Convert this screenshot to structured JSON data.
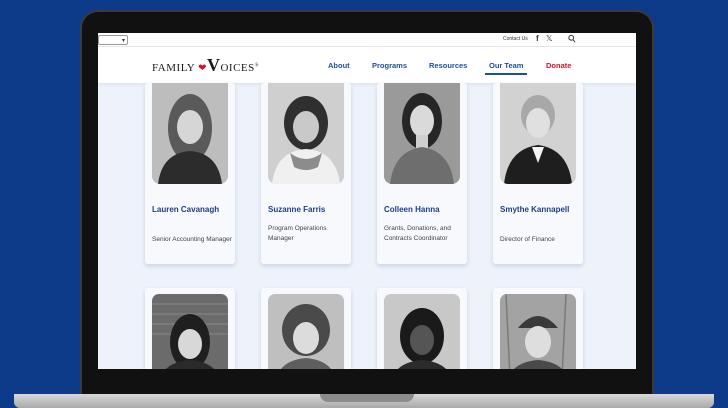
{
  "topbar": {
    "contact_label": "Contact Us",
    "facebook_glyph": "f",
    "x_glyph": "𝕏"
  },
  "brand": {
    "logo_family": "FAMILY",
    "logo_oices": "OICES",
    "logo_reg": "®"
  },
  "nav": {
    "about": "About",
    "programs": "Programs",
    "resources": "Resources",
    "our_team": "Our Team",
    "donate": "Donate",
    "active": "Our Team"
  },
  "team": [
    {
      "name": "Lauren Cavanagh",
      "role": "Senior Accounting Manager"
    },
    {
      "name": "Suzanne Farris",
      "role": "Program Operations Manager"
    },
    {
      "name": "Colleen Hanna",
      "role": "Grants, Donations, and Contracts Coordinator"
    },
    {
      "name": "Smythe Kannapell",
      "role": "Director of Finance"
    }
  ],
  "colors": {
    "brand_blue": "#1f4e9c",
    "donate_red": "#d3122b",
    "page_bg": "#0e3a8a"
  },
  "icons": [
    "facebook-icon",
    "x-icon",
    "search-icon",
    "heart-icon"
  ]
}
